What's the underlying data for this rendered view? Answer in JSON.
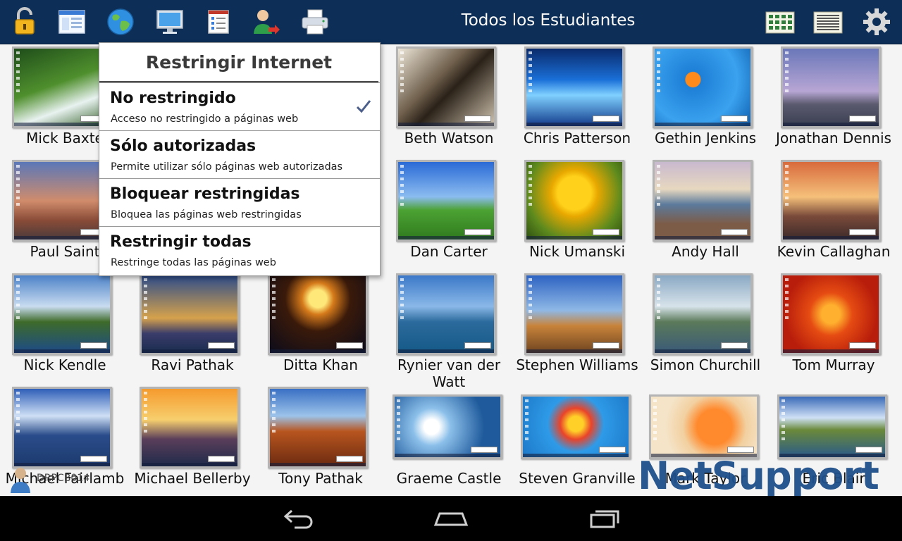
{
  "toolbar": {
    "title": "Todos los Estudiantes",
    "icons": [
      "lock-icon",
      "window-icon",
      "globe-icon",
      "monitor-icon",
      "checklist-icon",
      "user-logoff-icon",
      "printer-icon",
      "thumbnail-grid-icon",
      "list-view-icon",
      "gear-icon"
    ]
  },
  "dropdown": {
    "title": "Restringir Internet",
    "items": [
      {
        "title": "No restringido",
        "desc": "Acceso no restringido a páginas web",
        "checked": true
      },
      {
        "title": "Sólo autorizadas",
        "desc": "Permite utilizar sólo páginas web autorizadas",
        "checked": false
      },
      {
        "title": "Bloquear restringidas",
        "desc": "Bloquea las páginas web restringidas",
        "checked": false
      },
      {
        "title": "Restringir todas",
        "desc": "Restringe todas las páginas web",
        "checked": false
      }
    ]
  },
  "students": [
    {
      "name": "Mick Baxte",
      "wallpaper": "forest-waterfall"
    },
    {
      "name": "Beth Watson",
      "wallpaper": "dog-sepia"
    },
    {
      "name": "Chris Patterson",
      "wallpaper": "blue-aurora"
    },
    {
      "name": "Gethin Jenkins",
      "wallpaper": "goldfish"
    },
    {
      "name": "Jonathan Dennis",
      "wallpaper": "stonehenge"
    },
    {
      "name": "Paul Saint",
      "wallpaper": "lighthouse"
    },
    {
      "name": "Dan Carter",
      "wallpaper": "green-hill"
    },
    {
      "name": "Nick Umanski",
      "wallpaper": "tulips"
    },
    {
      "name": "Andy Hall",
      "wallpaper": "river-valley"
    },
    {
      "name": "Kevin Callaghan",
      "wallpaper": "coast-sunset"
    },
    {
      "name": "Nick Kendle",
      "wallpaper": "cliff-castle"
    },
    {
      "name": "Ravi Pathak",
      "wallpaper": "tower-bridge"
    },
    {
      "name": "Ditta Khan",
      "wallpaper": "fireworks"
    },
    {
      "name": "Rynier van der Watt",
      "wallpaper": "harbour-city"
    },
    {
      "name": "Stephen Williams",
      "wallpaper": "baobab"
    },
    {
      "name": "Simon Churchill",
      "wallpaper": "lake-canoe"
    },
    {
      "name": "Tom Murray",
      "wallpaper": "orange-flower"
    },
    {
      "name": "Michael Fairlamb",
      "wallpaper": "mountain-lake"
    },
    {
      "name": "Michael Bellerby",
      "wallpaper": "sunset-sea"
    },
    {
      "name": "Tony Pathak",
      "wallpaper": "desert-butte"
    },
    {
      "name": "Graeme Castle",
      "wallpaper": "dandelion"
    },
    {
      "name": "Steven Granville",
      "wallpaper": "hot-air-balloon"
    },
    {
      "name": "Mark Taylor",
      "wallpaper": "orange-petals"
    },
    {
      "name": "Eric Blair",
      "wallpaper": "alps-lake"
    }
  ],
  "console": {
    "name": "DRPCB014"
  },
  "logo": {
    "text": "NetSupport"
  },
  "navbar": {
    "icons": [
      "back-icon",
      "home-icon",
      "recents-icon"
    ]
  }
}
